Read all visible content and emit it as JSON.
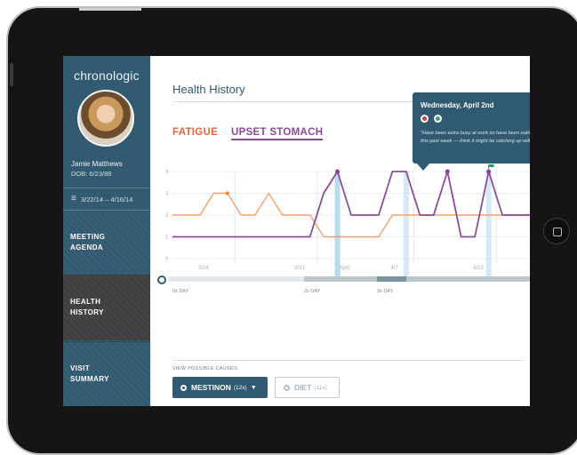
{
  "app": {
    "brand": "chronologic"
  },
  "patient": {
    "name": "Jamie Matthews",
    "dob": "DOB: 6/23/88"
  },
  "date_range": "3/22/14 – 4/16/14",
  "nav": [
    {
      "line1": "MEETING",
      "line2": "AGENDA",
      "active": false
    },
    {
      "line1": "HEALTH",
      "line2": "HISTORY",
      "active": true
    },
    {
      "line1": "VISIT",
      "line2": "SUMMARY",
      "active": false
    }
  ],
  "page": {
    "title": "Health History"
  },
  "symptoms": {
    "fatigue": "FATIGUE",
    "upset": "UPSET STOMACH"
  },
  "tooltip": {
    "date": "Wednesday, April 2nd",
    "note": "\"Have been extra busy at work so have been eating out a lot this past week — think it might be catching up with me.\""
  },
  "timeline": {
    "dose_0x": "0x DAY",
    "dose_2x": "2x DAY",
    "dose_3x": "3x DAY"
  },
  "causes": {
    "label": "VIEW POSSIBLE CAUSES:",
    "mestinon": "MESTINON",
    "mestinon_count": "(12x)",
    "diet": "DIET",
    "diet_count": "(11x)"
  },
  "colors": {
    "fatigue": "#f0a070",
    "upset": "#8e4b9c",
    "accent": "#2f5a71",
    "flag": "#2a9d6e",
    "highlight": "#a9d6ee"
  },
  "chart_data": {
    "type": "line",
    "y_ticks": [
      "0",
      "1",
      "2",
      "3",
      "4"
    ],
    "ylim": [
      0,
      4
    ],
    "x_ticks": [
      "3/24",
      "3/31",
      "April",
      "4/7",
      "4/13"
    ],
    "grid": true,
    "series": [
      {
        "name": "FATIGUE",
        "values": [
          2,
          2,
          2,
          3,
          3,
          2,
          2,
          3,
          2,
          2,
          2,
          1,
          1,
          1,
          1,
          1,
          2,
          2,
          2,
          2,
          2,
          2,
          2,
          2,
          2,
          2,
          2
        ]
      },
      {
        "name": "UPSET STOMACH",
        "values": [
          1,
          1,
          1,
          1,
          1,
          1,
          1,
          1,
          1,
          1,
          1,
          3,
          4,
          2,
          2,
          2,
          4,
          4,
          2,
          2,
          4,
          1,
          1,
          4,
          2,
          2,
          2
        ]
      }
    ],
    "highlighted_days": [
      12,
      17,
      23
    ]
  }
}
